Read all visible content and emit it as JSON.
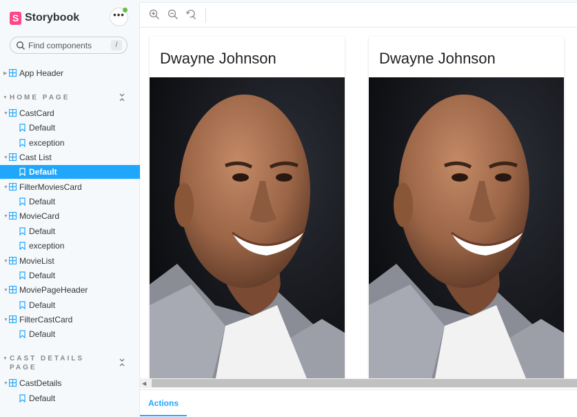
{
  "brand": {
    "name": "Storybook",
    "logo_letter": "S",
    "color": "#ff4785"
  },
  "menu": {
    "label": "•••",
    "status_color": "#66bf3c"
  },
  "search": {
    "placeholder": "Find components",
    "shortcut": "/"
  },
  "tree": {
    "top": [
      {
        "label": "App Header"
      }
    ],
    "home_page": {
      "title": "HOME PAGE",
      "components": [
        {
          "label": "CastCard",
          "stories": [
            "Default",
            "exception"
          ]
        },
        {
          "label": "Cast List",
          "stories": [
            "Default"
          ]
        },
        {
          "label": "FilterMoviesCard",
          "stories": [
            "Default"
          ]
        },
        {
          "label": "MovieCard",
          "stories": [
            "Default",
            "exception"
          ]
        },
        {
          "label": "MovieList",
          "stories": [
            "Default"
          ]
        },
        {
          "label": "MoviePageHeader",
          "stories": [
            "Default"
          ]
        },
        {
          "label": "FilterCastCard",
          "stories": [
            "Default"
          ]
        }
      ]
    },
    "cast_details_page": {
      "title_line1": "CAST DETAILS",
      "title_line2": "PAGE",
      "components": [
        {
          "label": "CastDetails",
          "stories": [
            "Default"
          ]
        }
      ]
    },
    "selected": "Cast List / Default"
  },
  "toolbar": {
    "icons": [
      "zoom-in-icon",
      "zoom-out-icon",
      "zoom-reset-icon"
    ]
  },
  "cards": [
    {
      "name": "Dwayne Johnson"
    },
    {
      "name": "Dwayne Johnson"
    }
  ],
  "addons": {
    "active_tab": "Actions"
  },
  "colors": {
    "accent": "#1ea7fd",
    "sidebar_bg": "#f6f9fc"
  }
}
